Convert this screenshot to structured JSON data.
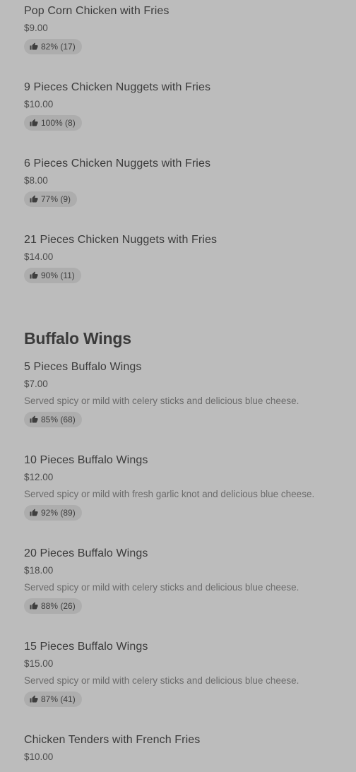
{
  "sections": [
    {
      "title": "",
      "items": [
        {
          "name": "Pop Corn Chicken with Fries",
          "price": "$9.00",
          "rating": "82% (17)"
        },
        {
          "name": "9 Pieces Chicken Nuggets with Fries",
          "price": "$10.00",
          "rating": "100% (8)"
        },
        {
          "name": "6 Pieces Chicken Nuggets with Fries",
          "price": "$8.00",
          "rating": "77% (9)"
        },
        {
          "name": "21 Pieces Chicken Nuggets with Fries",
          "price": "$14.00",
          "rating": "90% (11)"
        }
      ]
    },
    {
      "title": "Buffalo Wings",
      "items": [
        {
          "name": "5 Pieces Buffalo Wings",
          "price": "$7.00",
          "description": "Served spicy or mild with celery sticks and delicious blue cheese.",
          "rating": "85% (68)"
        },
        {
          "name": "10 Pieces Buffalo Wings",
          "price": "$12.00",
          "description": "Served spicy or mild with fresh garlic knot and delicious blue cheese.",
          "rating": "92% (89)"
        },
        {
          "name": "20 Pieces Buffalo Wings",
          "price": "$18.00",
          "description": "Served spicy or mild with celery sticks and delicious blue cheese.",
          "rating": "88% (26)"
        },
        {
          "name": "15 Pieces Buffalo Wings",
          "price": "$15.00",
          "description": "Served spicy or mild with celery sticks and delicious blue cheese.",
          "rating": "87% (41)"
        },
        {
          "name": "Chicken Tenders with French Fries",
          "price": "$10.00"
        }
      ]
    }
  ],
  "icons": {
    "rating": "thumbs-up-icon"
  },
  "colors": {
    "background": "#bcbcbc",
    "badge": "#adadad",
    "text": "#3a3a3a",
    "description": "#6b6b6b"
  }
}
